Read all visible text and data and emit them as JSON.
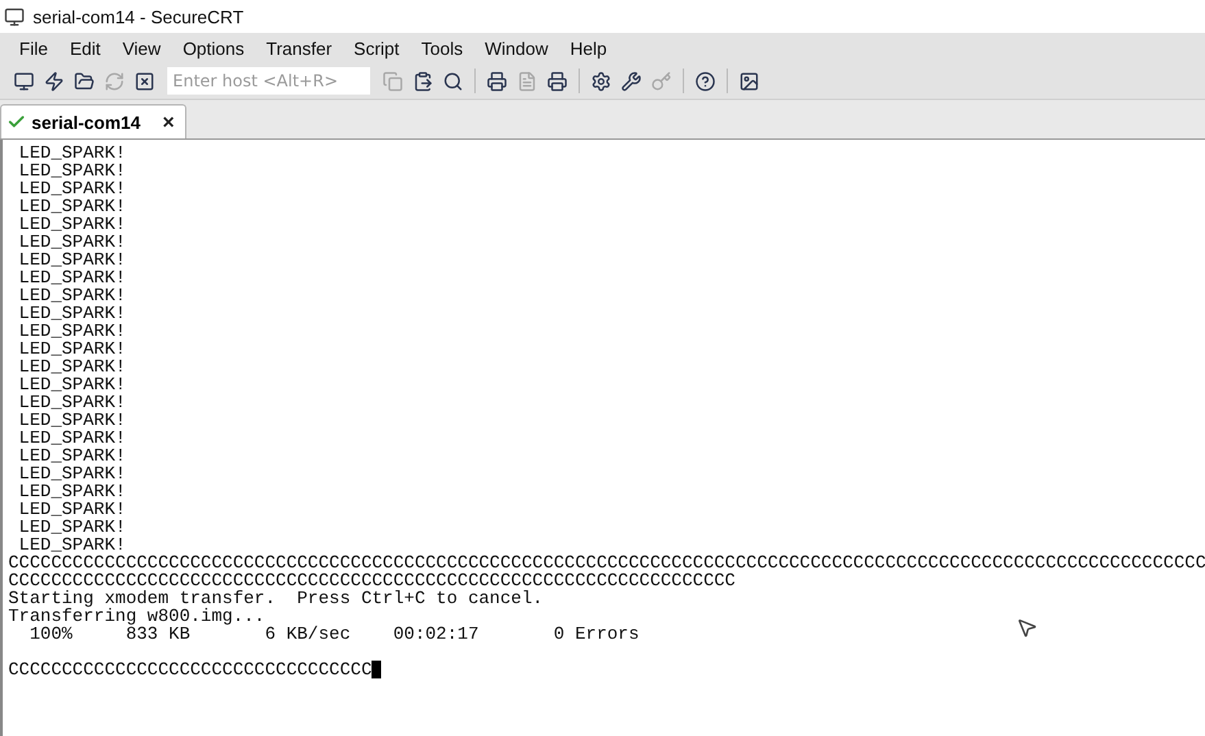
{
  "window": {
    "title": "serial-com14 - SecureCRT"
  },
  "menu": [
    "File",
    "Edit",
    "View",
    "Options",
    "Transfer",
    "Script",
    "Tools",
    "Window",
    "Help"
  ],
  "toolbar": {
    "left_buttons": [
      {
        "disabled": false
      },
      {
        "disabled": false
      },
      {
        "disabled": false
      },
      {
        "disabled": true
      },
      {
        "disabled": false
      }
    ],
    "host_field": {
      "placeholder": "Enter host <Alt+R>"
    },
    "right_buttons": [
      {
        "disabled": true
      },
      {
        "disabled": false
      },
      {
        "disabled": false
      },
      {
        "disabled": false
      },
      {
        "disabled": true
      },
      {
        "disabled": false
      },
      {
        "disabled": false
      },
      {
        "disabled": false
      },
      {
        "disabled": true
      },
      {
        "disabled": false
      },
      {
        "disabled": false
      }
    ]
  },
  "tabs": [
    {
      "label": "serial-com14",
      "selected": true,
      "close": "×"
    }
  ],
  "terminal": {
    "lines": [
      " LED_SPARK!",
      " LED_SPARK!",
      " LED_SPARK!",
      " LED_SPARK!",
      " LED_SPARK!",
      " LED_SPARK!",
      " LED_SPARK!",
      " LED_SPARK!",
      " LED_SPARK!",
      " LED_SPARK!",
      " LED_SPARK!",
      " LED_SPARK!",
      " LED_SPARK!",
      " LED_SPARK!",
      " LED_SPARK!",
      " LED_SPARK!",
      " LED_SPARK!",
      " LED_SPARK!",
      " LED_SPARK!",
      " LED_SPARK!",
      " LED_SPARK!",
      " LED_SPARK!",
      " LED_SPARK!",
      "CCCCCCCCCCCCCCCCCCCCCCCCCCCCCCCCCCCCCCCCCCCCCCCCCCCCCCCCCCCCCCCCCCCCCCCCCCCCCCCCCCCCCCCCCCCCCCCCCCCCCCCCCCCCCCCC",
      "CCCCCCCCCCCCCCCCCCCCCCCCCCCCCCCCCCCCCCCCCCCCCCCCCCCCCCCCCCCCCCCCCCCC",
      "Starting xmodem transfer.  Press Ctrl+C to cancel.",
      "Transferring w800.img...",
      "  100%     833 KB       6 KB/sec    00:02:17       0 Errors"
    ],
    "prompt_line": "CCCCCCCCCCCCCCCCCCCCCCCCCCCCCCCCCC"
  }
}
